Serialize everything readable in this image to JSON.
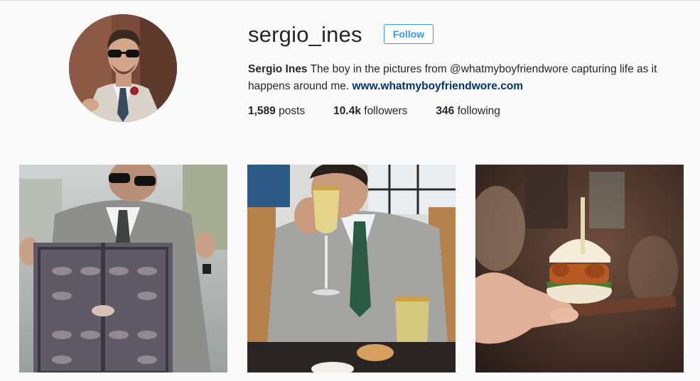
{
  "profile": {
    "username": "sergio_ines",
    "follow_label": "Follow",
    "full_name": "Sergio Ines",
    "bio_text": " The boy in the pictures from @whatmyboyfriendwore capturing life as it happens around me. ",
    "website": "www.whatmyboyfriendwore.com"
  },
  "stats": {
    "posts_count": "1,589",
    "posts_label": " posts",
    "followers_count": "10.4k",
    "followers_label": " followers",
    "following_count": "346",
    "following_label": " following"
  },
  "colors": {
    "accent": "#3897f0",
    "link": "#003569",
    "background": "#fafafa",
    "text": "#262626"
  },
  "posts": [
    {
      "subject": "man-holding-patterned-scarf"
    },
    {
      "subject": "man-drinking-white-wine"
    },
    {
      "subject": "hand-holding-slider-burger"
    }
  ]
}
